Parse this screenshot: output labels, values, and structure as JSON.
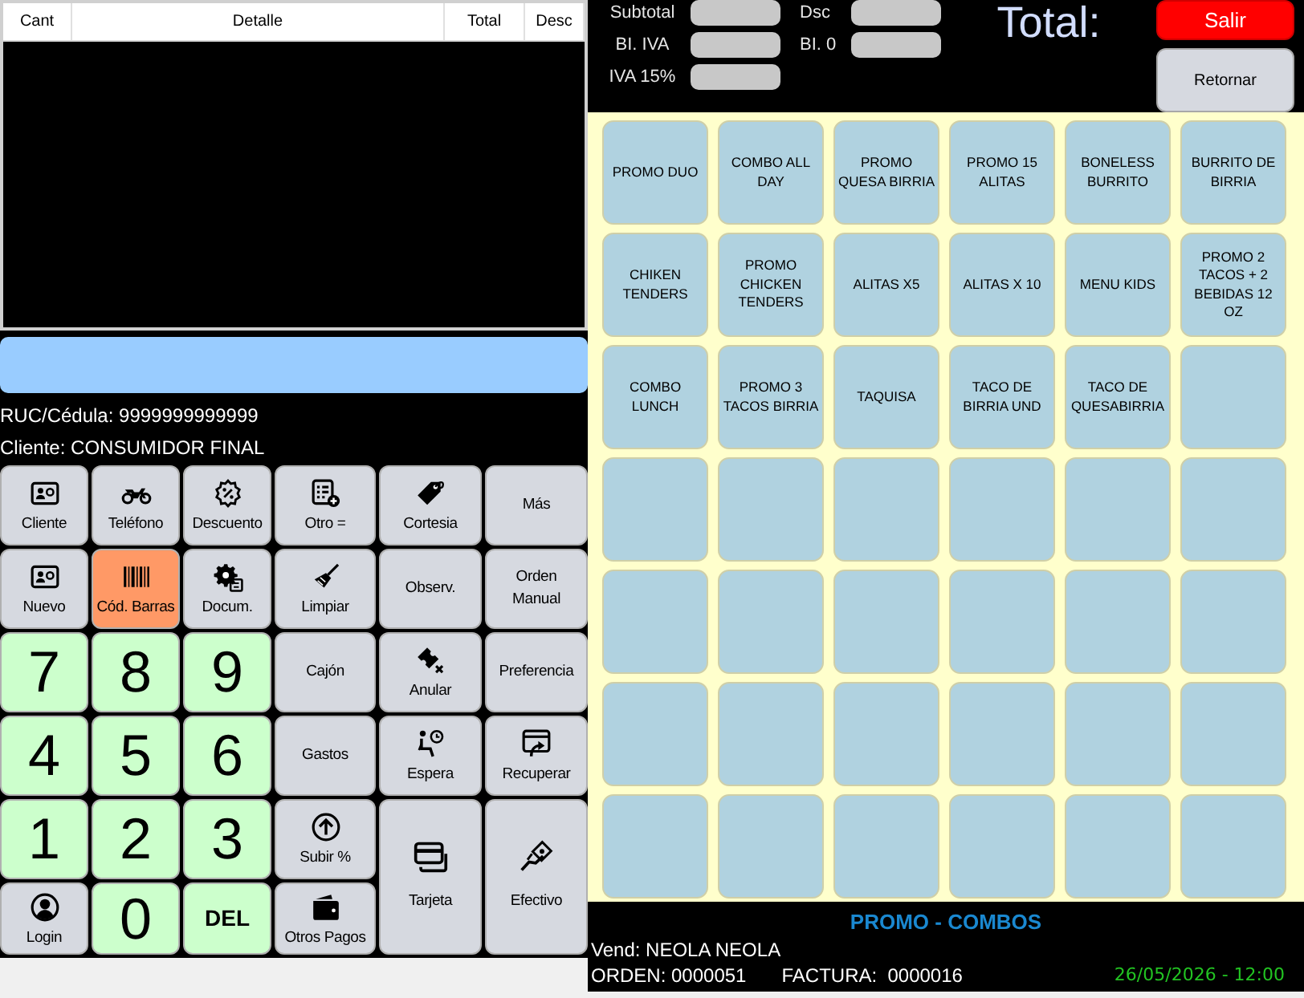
{
  "table": {
    "columns": [
      "Cant",
      "Detalle",
      "Total",
      "Desc"
    ]
  },
  "customer": {
    "id_text": "RUC/Cédula: 9999999999999",
    "name_text": "Cliente: CONSUMIDOR FINAL"
  },
  "keypad": [
    {
      "label": "Cliente",
      "kind": "icon",
      "active": false
    },
    {
      "label": "Teléfono",
      "kind": "icon",
      "active": false
    },
    {
      "label": "Descuento",
      "kind": "icon",
      "active": false
    },
    {
      "label": "Otro =",
      "kind": "icon",
      "active": false
    },
    {
      "label": "Cortesia",
      "kind": "icon",
      "active": false
    },
    {
      "label": "Más",
      "kind": "text",
      "active": false
    },
    {
      "label": "Nuevo",
      "kind": "icon",
      "active": false
    },
    {
      "label": "Cód. Barras",
      "kind": "icon",
      "active": true
    },
    {
      "label": "Docum.",
      "kind": "icon",
      "active": false
    },
    {
      "label": "Limpiar",
      "kind": "icon",
      "active": false
    },
    {
      "label": "Observ.",
      "kind": "text",
      "active": false
    },
    {
      "label": "Orden Manual",
      "kind": "text",
      "active": false
    },
    {
      "label": "7",
      "kind": "digit",
      "active": false
    },
    {
      "label": "8",
      "kind": "digit",
      "active": false
    },
    {
      "label": "9",
      "kind": "digit",
      "active": false
    },
    {
      "label": "Cajón",
      "kind": "text",
      "active": false
    },
    {
      "label": "Anular",
      "kind": "icon",
      "active": false
    },
    {
      "label": "Preferencia",
      "kind": "text",
      "active": false
    },
    {
      "label": "4",
      "kind": "digit",
      "active": false
    },
    {
      "label": "5",
      "kind": "digit",
      "active": false
    },
    {
      "label": "6",
      "kind": "digit",
      "active": false
    },
    {
      "label": "Gastos",
      "kind": "text",
      "active": false
    },
    {
      "label": "Espera",
      "kind": "icon",
      "active": false
    },
    {
      "label": "Recuperar",
      "kind": "icon",
      "active": false
    },
    {
      "label": "1",
      "kind": "digit",
      "active": false
    },
    {
      "label": "2",
      "kind": "digit",
      "active": false
    },
    {
      "label": "3",
      "kind": "digit",
      "active": false
    },
    {
      "label": "Subir %",
      "kind": "icon",
      "active": false
    },
    {
      "label": "Tarjeta",
      "kind": "large",
      "active": false
    },
    {
      "label": "Efectivo",
      "kind": "large",
      "active": false
    },
    {
      "label": "Login",
      "kind": "icon",
      "active": false
    },
    {
      "label": "0",
      "kind": "digit",
      "active": false
    },
    {
      "label": "DEL",
      "kind": "key",
      "active": false
    },
    {
      "label": "Otros Pagos",
      "kind": "icon",
      "active": false
    }
  ],
  "summary_columns": [
    {
      "fields": [
        {
          "label": "Subtotal"
        },
        {
          "label": "BI. IVA"
        },
        {
          "label": "IVA 15%"
        }
      ]
    },
    {
      "fields": [
        {
          "label": "Dsc"
        },
        {
          "label": "BI. 0"
        }
      ]
    }
  ],
  "total_label": "Total:",
  "header_buttons": [
    {
      "label": "Salir",
      "kind": "exit"
    },
    {
      "label": "Retornar",
      "kind": "back"
    }
  ],
  "products": [
    "PROMO DUO",
    "COMBO ALL DAY",
    "PROMO QUESA BIRRIA",
    "PROMO 15 ALITAS",
    "BONELESS BURRITO",
    "BURRITO DE BIRRIA",
    "CHIKEN TENDERS",
    "PROMO CHICKEN TENDERS",
    "ALITAS X5",
    "ALITAS X 10",
    "MENU KIDS",
    "PROMO 2 TACOS + 2 BEBIDAS 12 OZ",
    "COMBO LUNCH",
    "PROMO 3 TACOS BIRRIA",
    "TAQUISA",
    "TACO DE BIRRIA UND",
    "TACO DE QUESABIRRIA"
  ],
  "footer": {
    "category": "PROMO - COMBOS",
    "vendor": "Vend: NEOLA NEOLA",
    "order": "ORDEN: 0000051",
    "invoice": "FACTURA:  0000016",
    "datetime": "26/05/2026 - 12:00"
  }
}
